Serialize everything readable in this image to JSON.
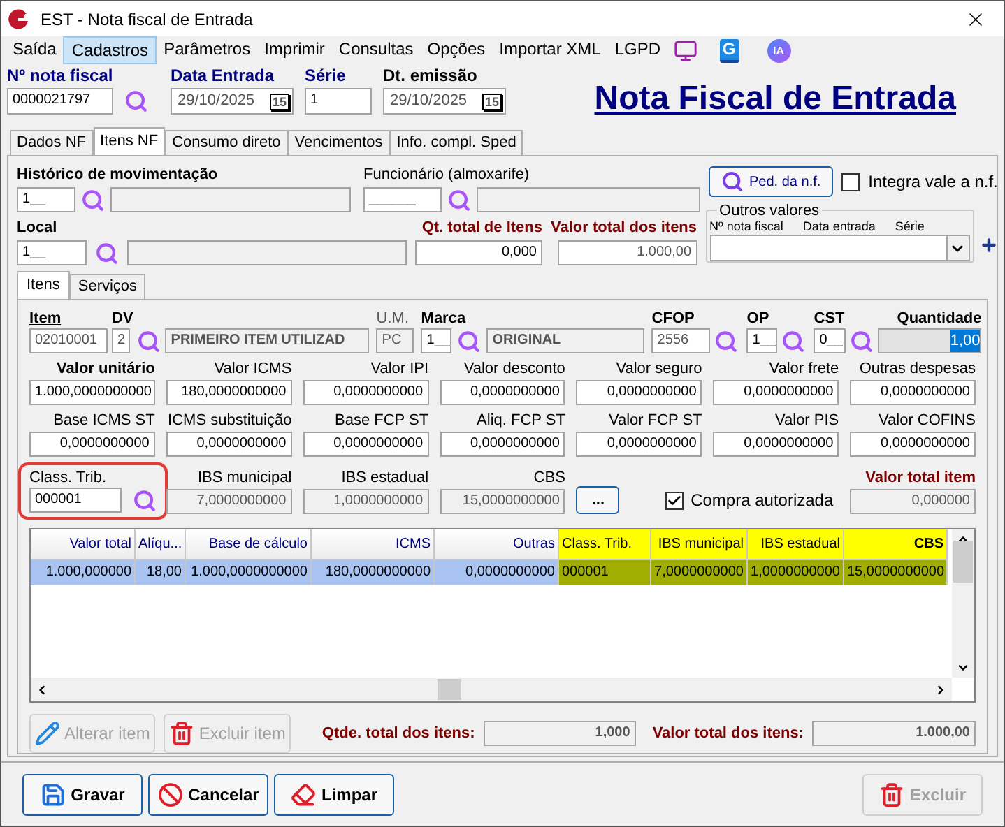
{
  "window": {
    "title": "EST - Nota fiscal de Entrada"
  },
  "menu": [
    {
      "label": "Saída",
      "selected": false
    },
    {
      "label": "Cadastros",
      "selected": true
    },
    {
      "label": "Parâmetros",
      "selected": false
    },
    {
      "label": "Imprimir",
      "selected": false
    },
    {
      "label": "Consultas",
      "selected": false
    },
    {
      "label": "Opções",
      "selected": false
    },
    {
      "label": "Importar XML",
      "selected": false
    },
    {
      "label": "LGPD",
      "selected": false
    }
  ],
  "menu_logo_letter": "G",
  "assistant_label": "IA",
  "header": {
    "number": {
      "label": "Nº nota fiscal",
      "value": "0000021797"
    },
    "entry_date": {
      "label": "Data Entrada",
      "value": "29/10/2025",
      "calendar": "15"
    },
    "series": {
      "label": "Série",
      "value": "1"
    },
    "issue_date": {
      "label": "Dt. emissão",
      "value": "29/10/2025",
      "calendar": "15"
    },
    "title": "Nota Fiscal de Entrada"
  },
  "tabs": [
    {
      "label": "Dados NF",
      "selected": false
    },
    {
      "label": "Itens NF",
      "selected": true
    },
    {
      "label": "Consumo direto",
      "selected": false
    },
    {
      "label": "Vencimentos",
      "selected": false
    },
    {
      "label": "Info. compl. Sped",
      "selected": false
    }
  ],
  "movement": {
    "label": "Histórico de movimentação",
    "code": "1__"
  },
  "employee": {
    "label": "Funcionário (almoxarife)",
    "code": "______"
  },
  "order_button": "Ped. da n.f.",
  "integrate": {
    "label": "Integra vale a n.f.",
    "checked": false
  },
  "location": {
    "label": "Local",
    "code": "1__"
  },
  "totals_top": [
    {
      "label": "Qt. total de Itens",
      "value": "0,000",
      "readonly": false
    },
    {
      "label": "Valor total dos itens",
      "value": "1.000,00",
      "readonly": true
    }
  ],
  "other_values": {
    "title": "Outros valores",
    "columns": [
      "Nº nota fiscal",
      "Data entrada",
      "Série"
    ]
  },
  "subtabs": [
    {
      "label": "Itens",
      "selected": true
    },
    {
      "label": "Serviços",
      "selected": false
    }
  ],
  "item_row": {
    "item": {
      "label": "Item",
      "value": "02010001",
      "readonly": true
    },
    "dv": {
      "label": "DV",
      "value": "2",
      "readonly": true
    },
    "description": "PRIMEIRO ITEM UTILIZAD",
    "um": {
      "label": "U.M.",
      "value": "PC",
      "readonly": true
    },
    "brand": {
      "label": "Marca",
      "code": "1__",
      "name": "ORIGINAL"
    },
    "cfop": {
      "label": "CFOP",
      "value": "2556",
      "readonly": true
    },
    "op": {
      "label": "OP",
      "value": "1__"
    },
    "cst": {
      "label": "CST",
      "value": "0__"
    },
    "quantity": {
      "label": "Quantidade",
      "value": "1,00"
    }
  },
  "value_rows": [
    [
      {
        "label": "Valor unitário",
        "value": "1.000,0000000000",
        "readonly": false
      },
      {
        "label": "Valor ICMS",
        "value": "180,0000000000",
        "readonly": false
      },
      {
        "label": "Valor IPI",
        "value": "0,0000000000",
        "readonly": false
      },
      {
        "label": "Valor desconto",
        "value": "0,0000000000",
        "readonly": false
      },
      {
        "label": "Valor seguro",
        "value": "0,0000000000",
        "readonly": false
      },
      {
        "label": "Valor frete",
        "value": "0,0000000000",
        "readonly": false
      },
      {
        "label": "Outras despesas",
        "value": "0,0000000000",
        "readonly": false
      }
    ],
    [
      {
        "label": "Base ICMS ST",
        "value": "0,0000000000",
        "readonly": false
      },
      {
        "label": "ICMS substituição",
        "value": "0,0000000000",
        "readonly": false
      },
      {
        "label": "Base FCP ST",
        "value": "0,0000000000",
        "readonly": false
      },
      {
        "label": "Aliq. FCP ST",
        "value": "0,0000000000",
        "readonly": false
      },
      {
        "label": "Valor FCP ST",
        "value": "0,0000000000",
        "readonly": false
      },
      {
        "label": "Valor PIS",
        "value": "0,0000000000",
        "readonly": false
      },
      {
        "label": "Valor COFINS",
        "value": "0,0000000000",
        "readonly": false
      }
    ]
  ],
  "tax_row": {
    "class": {
      "label": "Class. Trib.",
      "value": "000001"
    },
    "fields": [
      {
        "label": "IBS municipal",
        "value": "7,0000000000",
        "readonly": true
      },
      {
        "label": "IBS estadual",
        "value": "1,0000000000",
        "readonly": true
      },
      {
        "label": "CBS",
        "value": "15,0000000000",
        "readonly": true
      }
    ],
    "more": "...",
    "authorized": {
      "label": "Compra autorizada",
      "checked": true
    },
    "total_item": {
      "label": "Valor total item",
      "value": "0,000000",
      "readonly": true
    }
  },
  "grid": {
    "columns": [
      {
        "label": "Valor total",
        "highlighted": false
      },
      {
        "label": "Alíqu...",
        "highlighted": false
      },
      {
        "label": "Base de cálculo",
        "highlighted": false
      },
      {
        "label": "ICMS",
        "highlighted": false
      },
      {
        "label": "Outras",
        "highlighted": false
      },
      {
        "label": "Class. Trib.",
        "highlighted": true
      },
      {
        "label": "IBS municipal",
        "highlighted": true
      },
      {
        "label": "IBS estadual",
        "highlighted": true
      },
      {
        "label": "CBS",
        "highlighted": true
      }
    ],
    "rows": [
      {
        "selected": true,
        "cells": [
          "1.000,000000",
          "18,00",
          "1.000,0000000000",
          "180,0000000000",
          "0,0000000000",
          "000001",
          "7,0000000000",
          "1,0000000000",
          "15,0000000000"
        ]
      }
    ]
  },
  "actions": [
    {
      "label": "Alterar item",
      "disabled": true
    },
    {
      "label": "Excluir item",
      "disabled": true
    }
  ],
  "grid_totals": [
    {
      "label": "Qtde. total dos itens:",
      "value": "1,000"
    },
    {
      "label": "Valor total dos itens:",
      "value": "1.000,00"
    }
  ],
  "footer": [
    {
      "label": "Gravar",
      "disabled": false
    },
    {
      "label": "Cancelar",
      "disabled": false
    },
    {
      "label": "Limpar",
      "disabled": false
    },
    {
      "label": "Excluir",
      "disabled": true
    }
  ]
}
